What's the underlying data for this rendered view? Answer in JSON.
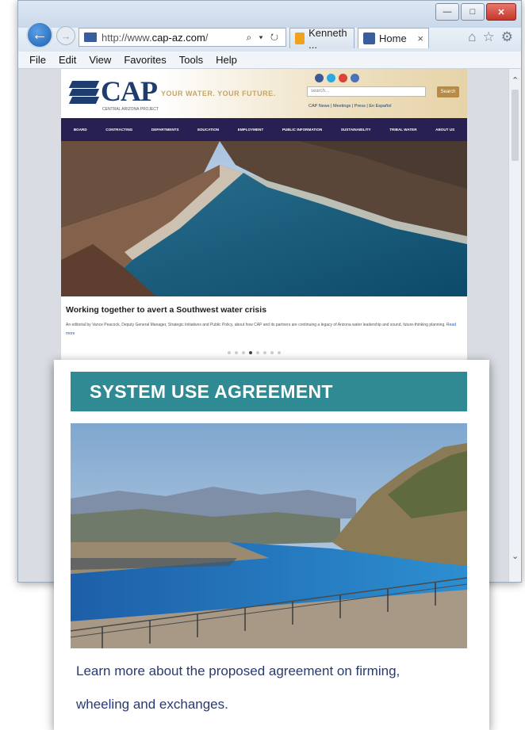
{
  "browser": {
    "address_prefix": "http://www.",
    "address_host": "cap-az.com",
    "address_suffix": "/",
    "address_tools": "⌕ ▾ ↻",
    "tabs": [
      {
        "label": "Kenneth ...",
        "color": "#f0a21b"
      },
      {
        "label": "Home",
        "close": "×",
        "color": "#3a5e9c"
      }
    ],
    "menu": [
      "File",
      "Edit",
      "View",
      "Favorites",
      "Tools",
      "Help"
    ]
  },
  "site": {
    "logo_text": "CAP",
    "logo_sub": "CENTRAL ARIZONA PROJECT",
    "tagline": "YOUR WATER. YOUR FUTURE.",
    "search_placeholder": "search...",
    "search_button": "Search",
    "header_links": "CAP News | Meetings | Press | En Español",
    "nav": [
      "BOARD",
      "CONTRACTING",
      "DEPARTMENTS",
      "EDUCATION",
      "EMPLOYMENT",
      "PUBLIC INFORMATION",
      "SUSTAINABILITY",
      "TRIBAL WATER",
      "ABOUT US"
    ],
    "headline": "Working together to avert a Southwest water crisis",
    "summary": "An editorial by Vance Peacock, Deputy General Manager, Strategic Initiatives and Public Policy, about how CAP and its partners are continuing a legacy of Arizona water leadership and sound, future-thinking planning.",
    "read_more": "Read more",
    "slide_count": 8,
    "active_slide": 4
  },
  "card": {
    "title": "SYSTEM USE AGREEMENT",
    "text": "Learn more about the proposed agreement on firming, wheeling and exchanges.",
    "banner_color": "#2f8a93",
    "text_color": "#283a73"
  },
  "colors": {
    "nav_bg": "#281f52",
    "brand_blue": "#1e3d6e",
    "gold": "#c7a566"
  }
}
